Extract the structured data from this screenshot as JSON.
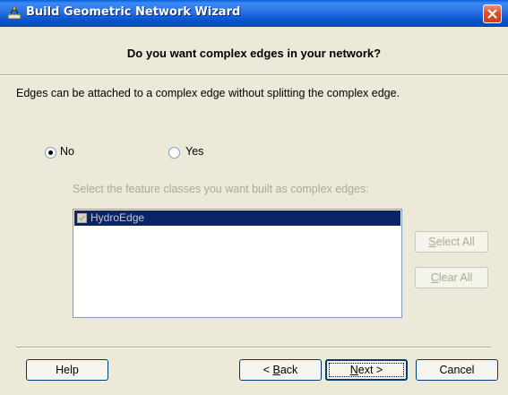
{
  "window": {
    "title": "Build Geometric Network Wizard",
    "title_icon": "network-wizard-icon",
    "close_icon": "close-icon"
  },
  "heading": "Do you want complex edges in your network?",
  "description": "Edges can be attached to a complex edge without splitting the complex edge.",
  "options": {
    "no": {
      "label": "No",
      "checked": true
    },
    "yes": {
      "label": "Yes",
      "checked": false
    }
  },
  "feature_classes": {
    "label": "Select the feature classes you want built as complex edges:",
    "items": [
      {
        "label": "HydroEdge",
        "checked": true,
        "selected": true,
        "enabled": false
      }
    ]
  },
  "buttons": {
    "select_all": {
      "pre": "",
      "underline": "S",
      "post": "elect All",
      "enabled": false
    },
    "clear_all": {
      "pre": "",
      "underline": "C",
      "post": "lear All",
      "enabled": false
    },
    "help": {
      "label": "Help"
    },
    "back": {
      "pre": "< ",
      "underline": "B",
      "post": "ack"
    },
    "next": {
      "pre": "",
      "underline": "N",
      "post": "ext >",
      "default": true
    },
    "cancel": {
      "label": "Cancel"
    }
  },
  "colors": {
    "face": "#ECE9D8",
    "titlebar": "#0A5FD8",
    "selection": "#0A246A",
    "disabled_text": "#ACA899",
    "button_border": "#003C74"
  }
}
